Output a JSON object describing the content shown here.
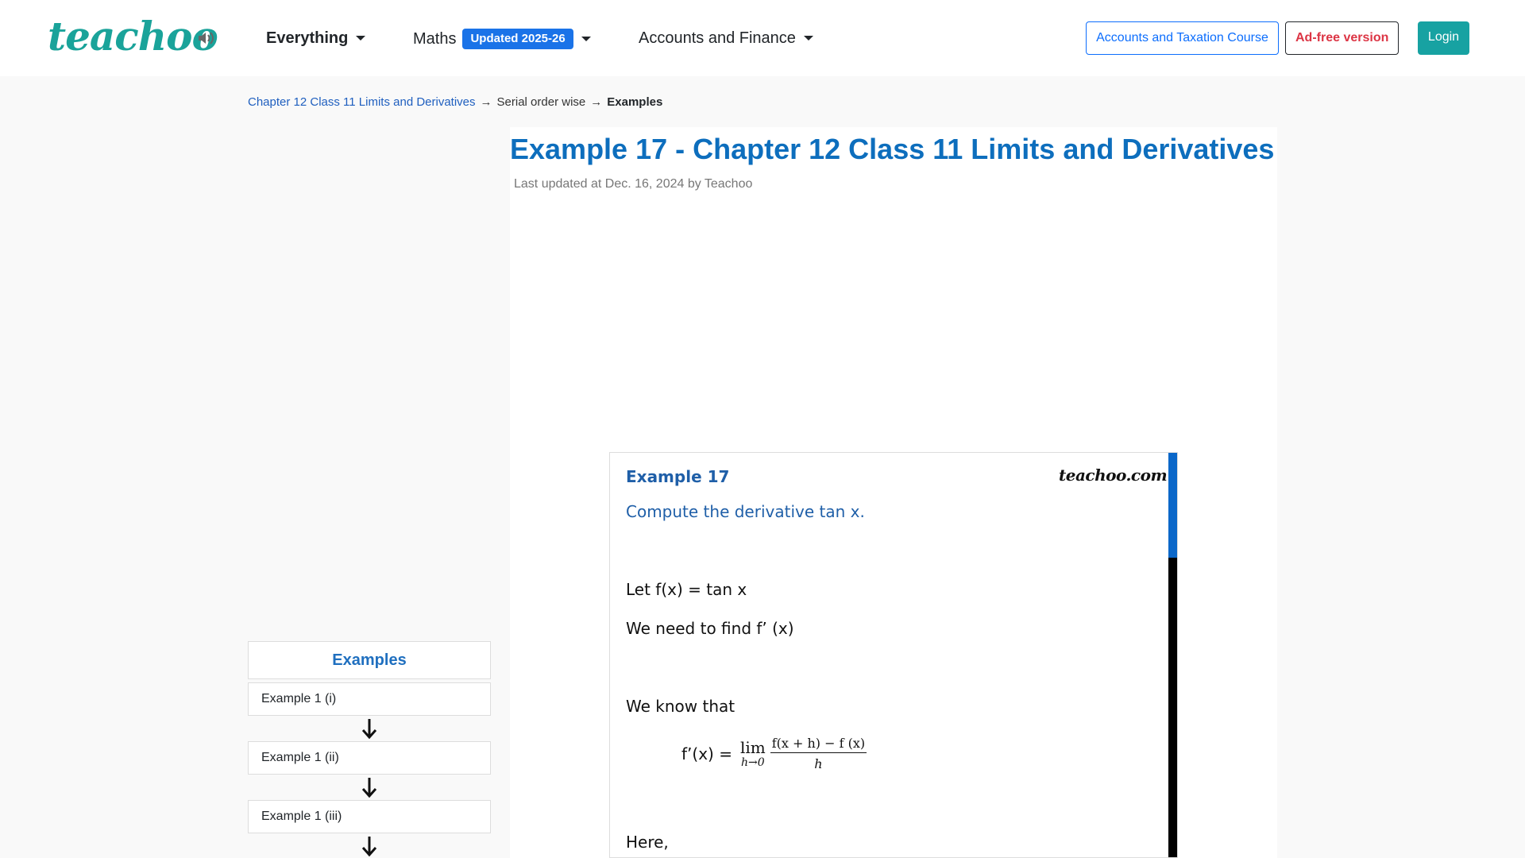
{
  "header": {
    "logo": "teachoo",
    "speaker_icon": "speaker-icon",
    "nav": [
      {
        "label": "Everything"
      },
      {
        "label": "Maths",
        "badge": "Updated 2025-26"
      },
      {
        "label": "Accounts and Finance"
      }
    ],
    "buttons": {
      "course": "Accounts and Taxation Course",
      "adfree": "Ad-free version",
      "login": "Login"
    }
  },
  "breadcrumb": {
    "chapter": "Chapter 12 Class 11 Limits and Derivatives",
    "section": "Serial order wise",
    "current": "Examples",
    "separator": "→"
  },
  "page": {
    "title": "Example 17 - Chapter 12 Class 11 Limits and Derivatives",
    "meta": "Last updated at Dec. 16, 2024 by Teachoo"
  },
  "question_image": {
    "example_title": "Example 17",
    "watermark": "teachoo.com",
    "question": "Compute the derivative tan x.",
    "line1": "Let f(x) = tan x",
    "line2": "We need to  find f’ (x)",
    "line3": "We know that",
    "formula_lhs": "f’(x) =",
    "lim": "lim",
    "lim_sub": "h→0",
    "frac_num": "f(x + h) − f (x)",
    "frac_den": "h",
    "line4": "Here,"
  },
  "sidebar": {
    "heading": "Examples",
    "items": [
      {
        "label": "Example 1 (i)"
      },
      {
        "label": "Example 1 (ii)"
      },
      {
        "label": "Example 1 (iii)"
      }
    ]
  },
  "colors": {
    "brand": "#1aa39a",
    "title": "#0d6ebd",
    "badge": "#1a73e8",
    "link": "#1f5fbf"
  }
}
